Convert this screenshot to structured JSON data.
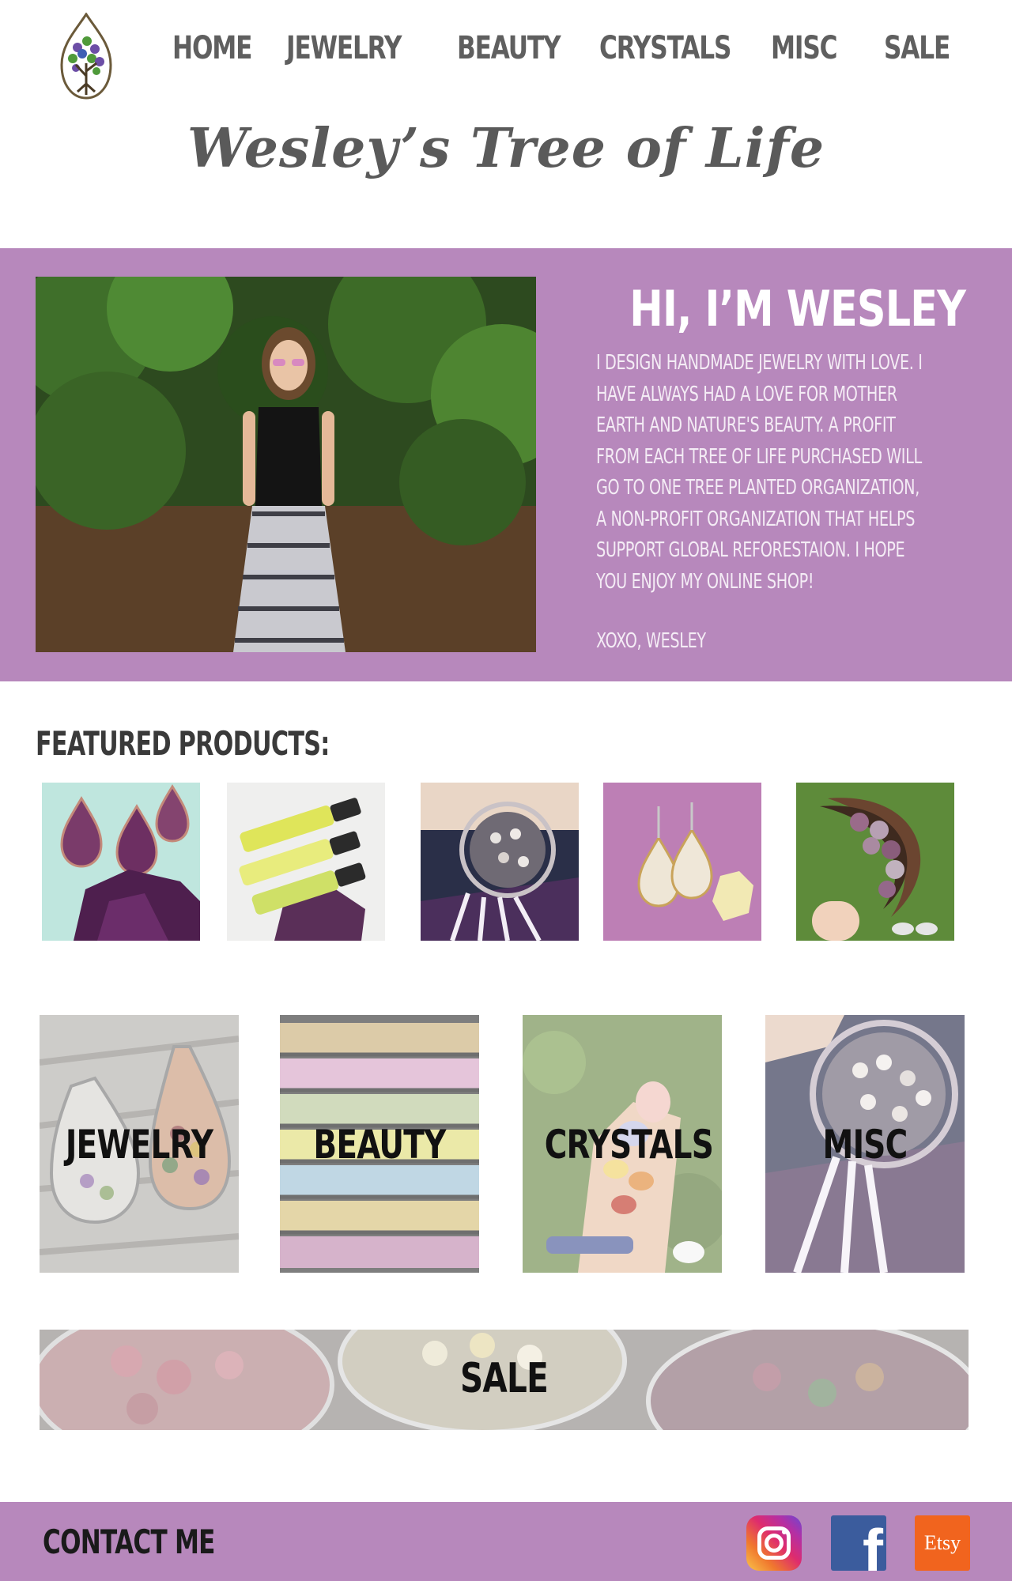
{
  "site": {
    "title": "Wesley’s Tree of Life"
  },
  "nav": {
    "items": [
      {
        "label": "HOME"
      },
      {
        "label": "JEWELRY"
      },
      {
        "label": "BEAUTY"
      },
      {
        "label": "CRYSTALS"
      },
      {
        "label": "MISC"
      },
      {
        "label": "SALE"
      }
    ]
  },
  "hero": {
    "heading": "HI, I’M WESLEY",
    "body": "I design handmade jewelry with love. I have always had a love for Mother Earth and nature's beauty. A profit from each Tree of Life purchased will go to One Tree Planted Organization, a non-profit organization that helps support global reforestaion. I hope you enjoy my online shop!",
    "signoff": "xoxo, Wesley"
  },
  "featured": {
    "title": "FEATURED PRODUCTS:",
    "products": [
      {
        "image": "tree-of-life-pendants-on-amethyst"
      },
      {
        "image": "be-calm-roller-bottles"
      },
      {
        "image": "tree-of-life-dreamcatcher"
      },
      {
        "image": "tree-of-life-earrings-on-purple"
      },
      {
        "image": "tumbled-stones-moon-bowl"
      }
    ]
  },
  "categories": [
    {
      "label": "JEWELRY"
    },
    {
      "label": "BEAUTY"
    },
    {
      "label": "CRYSTALS"
    },
    {
      "label": "MISC"
    }
  ],
  "sale": {
    "label": "SALE"
  },
  "footer": {
    "contact_label": "CONTACT ME",
    "social": [
      {
        "name": "instagram-icon"
      },
      {
        "name": "facebook-icon",
        "glyph": "f"
      },
      {
        "name": "etsy-icon",
        "glyph": "Etsy"
      }
    ]
  },
  "colors": {
    "accent_purple": "#b788bc",
    "nav_text": "#5f5f5f",
    "instagram": "#de2c6d",
    "facebook": "#3b5c9d",
    "etsy": "#f1641e"
  }
}
